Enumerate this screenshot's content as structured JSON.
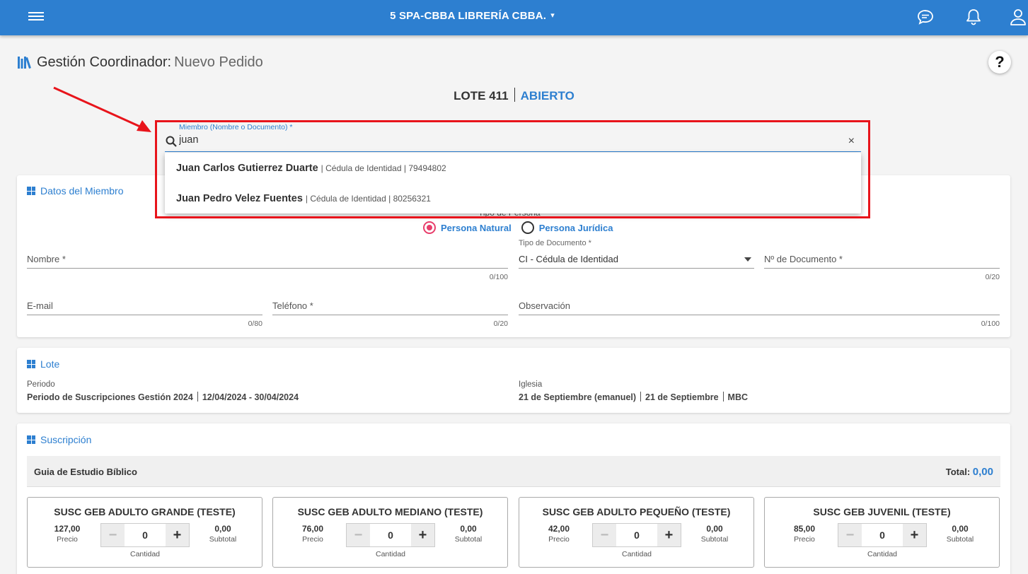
{
  "header": {
    "title": "5 SPA-CBBA LIBRERÍA CBBA.",
    "chevron": "▾"
  },
  "page": {
    "title_main": "Gestión Coordinador:",
    "title_sub": "Nuevo Pedido",
    "help": "?"
  },
  "lote_header": {
    "lote": "LOTE 411",
    "status": "ABIERTO"
  },
  "search": {
    "label": "Miembro (Nombre o Documento) *",
    "value": "juan",
    "clear": "×",
    "results": [
      {
        "name": "Juan Carlos Gutierrez Duarte",
        "detail": "| Cédula de Identidad | 79494802"
      },
      {
        "name": "Juan Pedro Velez Fuentes",
        "detail": "| Cédula de Identidad | 80256321"
      }
    ]
  },
  "member": {
    "title": "Datos del Miembro",
    "tipo_persona_label": "Tipo de Persona",
    "radio_natural": "Persona Natural",
    "radio_juridica": "Persona Jurídica",
    "nombre_label": "Nombre *",
    "nombre_counter": "0/100",
    "tipo_doc_label": "Tipo de Documento *",
    "tipo_doc_value": "CI - Cédula de Identidad",
    "nro_doc_label": "Nº de Documento *",
    "nro_doc_counter": "0/20",
    "email_label": "E-mail",
    "email_counter": "0/80",
    "telefono_label": "Teléfono *",
    "telefono_counter": "0/20",
    "observacion_label": "Observación",
    "observacion_counter": "0/100"
  },
  "lote": {
    "title": "Lote",
    "periodo_label": "Periodo",
    "periodo_name": "Periodo de Suscripciones Gestión 2024",
    "periodo_dates": "12/04/2024 - 30/04/2024",
    "iglesia_label": "Iglesia",
    "iglesia_1": "21 de Septiembre (emanuel)",
    "iglesia_2": "21 de Septiembre",
    "iglesia_3": "MBC"
  },
  "suscripcion": {
    "title": "Suscripción",
    "group": "Guia de Estudio Bíblico",
    "total_label": "Total:",
    "total_value": "0,00",
    "precio_label": "Precio",
    "subtotal_label": "Subtotal",
    "cantidad_label": "Cantidad",
    "minus": "−",
    "plus": "+",
    "products": [
      {
        "name": "SUSC GEB ADULTO GRANDE (TESTE)",
        "precio": "127,00",
        "cantidad": "0",
        "subtotal": "0,00"
      },
      {
        "name": "SUSC GEB ADULTO MEDIANO (TESTE)",
        "precio": "76,00",
        "cantidad": "0",
        "subtotal": "0,00"
      },
      {
        "name": "SUSC GEB ADULTO PEQUEÑO (TESTE)",
        "precio": "42,00",
        "cantidad": "0",
        "subtotal": "0,00"
      },
      {
        "name": "SUSC GEB JUVENIL (TESTE)",
        "precio": "85,00",
        "cantidad": "0",
        "subtotal": "0,00"
      }
    ]
  },
  "colors": {
    "primary": "#2d7fd0",
    "radio_active": "#e83e6b",
    "highlight": "#e8141b"
  },
  "icons": [
    "menu-icon",
    "chevron-down-icon",
    "chat-icon",
    "bell-icon",
    "user-icon",
    "books-icon",
    "help-icon",
    "search-icon",
    "close-icon",
    "windows-grid-icon",
    "minus-icon",
    "plus-icon",
    "caret-down-icon"
  ]
}
